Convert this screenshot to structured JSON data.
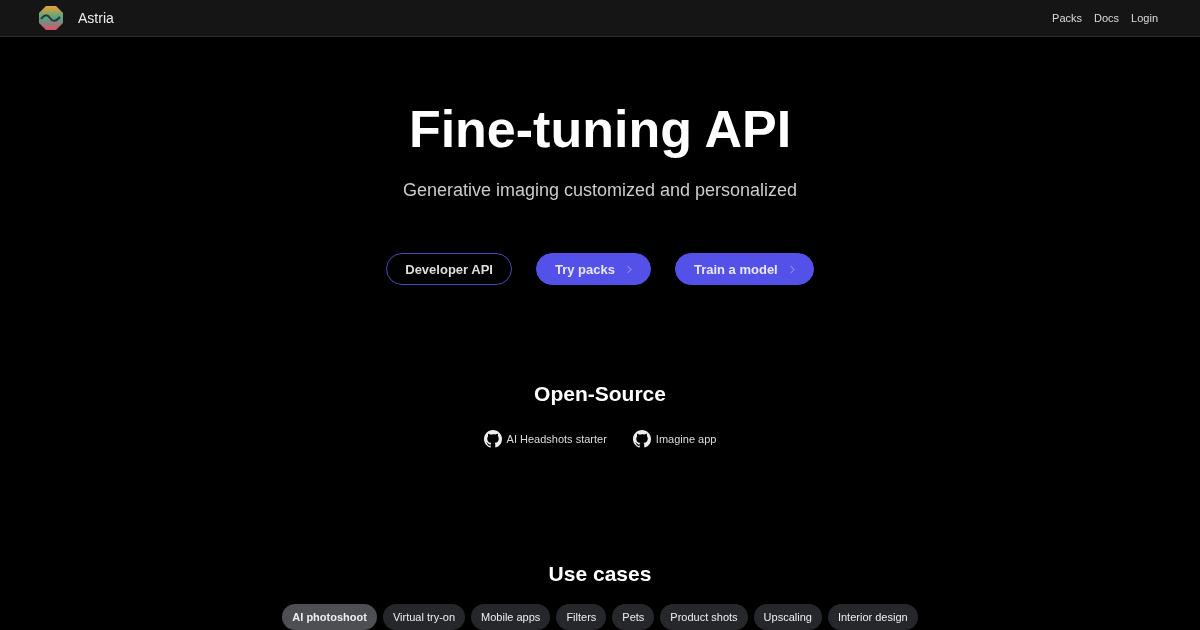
{
  "header": {
    "brand": "Astria",
    "nav": [
      "Packs",
      "Docs",
      "Login"
    ]
  },
  "hero": {
    "title": "Fine-tuning API",
    "subtitle": "Generative imaging customized and personalized",
    "buttons": [
      {
        "label": "Developer API",
        "kind": "outline"
      },
      {
        "label": "Try packs",
        "kind": "primary"
      },
      {
        "label": "Train a model",
        "kind": "primary"
      }
    ]
  },
  "open_source": {
    "title": "Open-Source",
    "links": [
      "AI Headshots starter",
      "Imagine app"
    ]
  },
  "use_cases": {
    "title": "Use cases",
    "tabs": [
      {
        "label": "AI photoshoot",
        "selected": true
      },
      {
        "label": "Virtual try-on",
        "selected": false
      },
      {
        "label": "Mobile apps",
        "selected": false
      },
      {
        "label": "Filters",
        "selected": false
      },
      {
        "label": "Pets",
        "selected": false
      },
      {
        "label": "Product shots",
        "selected": false
      },
      {
        "label": "Upscaling",
        "selected": false
      },
      {
        "label": "Interior design",
        "selected": false
      }
    ]
  }
}
